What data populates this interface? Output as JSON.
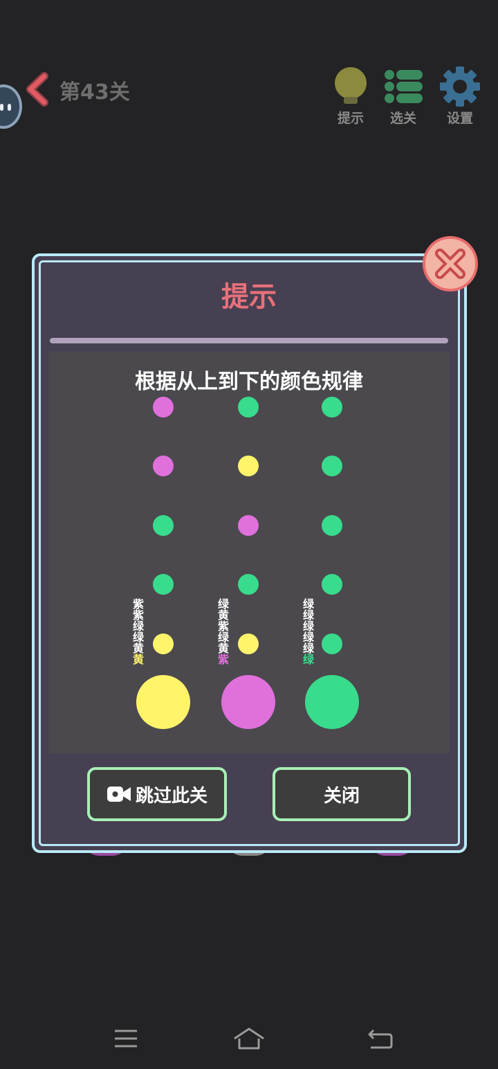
{
  "header": {
    "level_title": "第43关",
    "buttons": [
      {
        "icon": "lightbulb-icon",
        "label": "提示",
        "color": "#8c8a3e"
      },
      {
        "icon": "list-icon",
        "label": "选关",
        "color": "#3b8a5e"
      },
      {
        "icon": "gear-icon",
        "label": "设置",
        "color": "#3a6f93"
      }
    ]
  },
  "dialog": {
    "title": "提示",
    "hint_text": "根据从上到下的颜色规律",
    "columns": [
      {
        "label_prefix": "紫紫绿绿黄",
        "label_last": "黄",
        "last_color": "#fff46a",
        "dots": [
          "#e070dc",
          "#e070dc",
          "#38dc8c",
          "#38dc8c",
          "#fff46a"
        ],
        "answer": "#fff46a"
      },
      {
        "label_prefix": "绿黄紫绿黄",
        "label_last": "紫",
        "last_color": "#e070dc",
        "dots": [
          "#38dc8c",
          "#fff46a",
          "#e070dc",
          "#38dc8c",
          "#fff46a"
        ],
        "answer": "#e070dc"
      },
      {
        "label_prefix": "绿绿绿绿绿",
        "label_last": "绿",
        "last_color": "#38dc8c",
        "dots": [
          "#38dc8c",
          "#38dc8c",
          "#38dc8c",
          "#38dc8c",
          "#38dc8c"
        ],
        "answer": "#38dc8c"
      }
    ],
    "skip_label": "跳过此关",
    "close_label": "关闭"
  },
  "colors": {
    "purple": "#e070dc",
    "green": "#38dc8c",
    "yellow": "#fff46a",
    "accent_red": "#e8707a",
    "border_blue": "#b9e9f7",
    "button_border": "#a8efb8"
  }
}
